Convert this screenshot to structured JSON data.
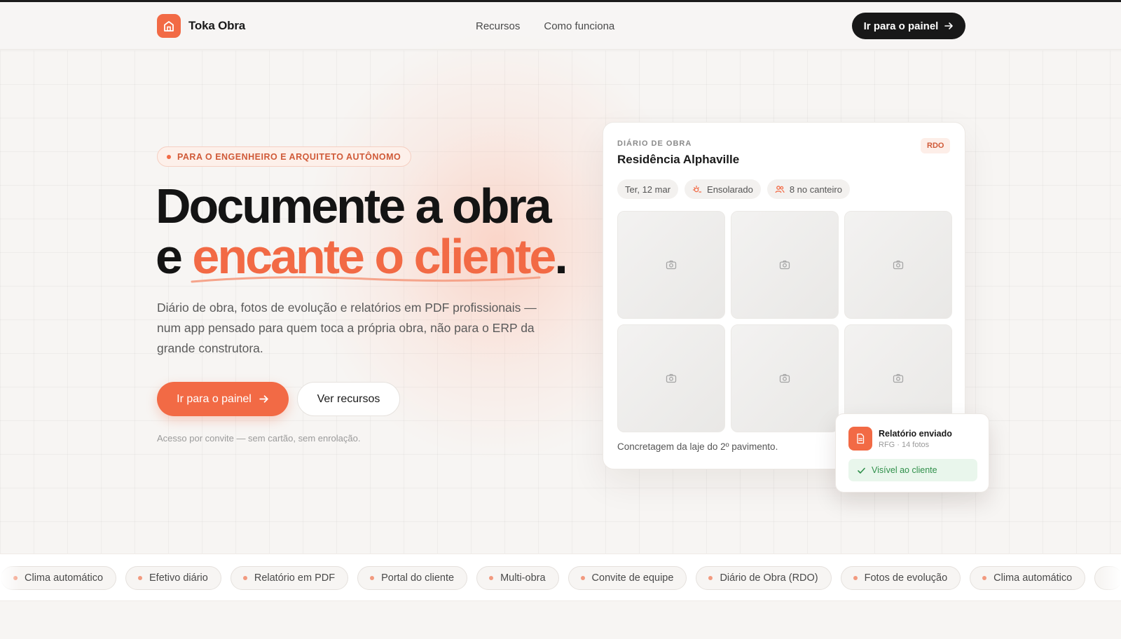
{
  "brand": {
    "name": "Toka Obra",
    "accent": "#f26a45"
  },
  "nav": {
    "items": [
      "Recursos",
      "Como funciona"
    ]
  },
  "header": {
    "cta_label": "Ir para o painel"
  },
  "hero": {
    "badge": "PARA O ENGENHEIRO E ARQUITETO AUTÔNOMO",
    "title_line1": "Documente a obra",
    "title_line2_prefix": "e ",
    "title_line2_accent": "encante o cliente",
    "title_line2_suffix": ".",
    "lead": "Diário de obra, fotos de evolução e relatórios em PDF profissionais — num app pensado para quem toca a própria obra, não para o ERP da grande construtora.",
    "primary_cta": "Ir para o painel",
    "secondary_cta": "Ver recursos",
    "note": "Acesso por convite — sem cartão, sem enrolação."
  },
  "card": {
    "kicker": "DIÁRIO DE OBRA",
    "title": "Residência Alphaville",
    "tag": "RDO",
    "chips": [
      {
        "label": "Ter, 12 mar",
        "icon": ""
      },
      {
        "label": "Ensolarado",
        "icon": "sun-icon"
      },
      {
        "label": "8 no canteiro",
        "icon": "people-icon"
      }
    ],
    "photo_icon": "camera-icon",
    "caption": "Concretagem da laje do 2º pavimento."
  },
  "toast": {
    "title": "Relatório enviado",
    "subtitle": "RFG · 14 fotos",
    "status": "Visível ao cliente",
    "status_color": "#2f8f4a"
  },
  "ticker": {
    "items": [
      "Clima automático",
      "Efetivo diário",
      "Relatório em PDF",
      "Portal do cliente",
      "Multi-obra",
      "Convite de equipe",
      "Diário de Obra (RDO)",
      "Fotos de evolução",
      "Clima automático"
    ]
  }
}
